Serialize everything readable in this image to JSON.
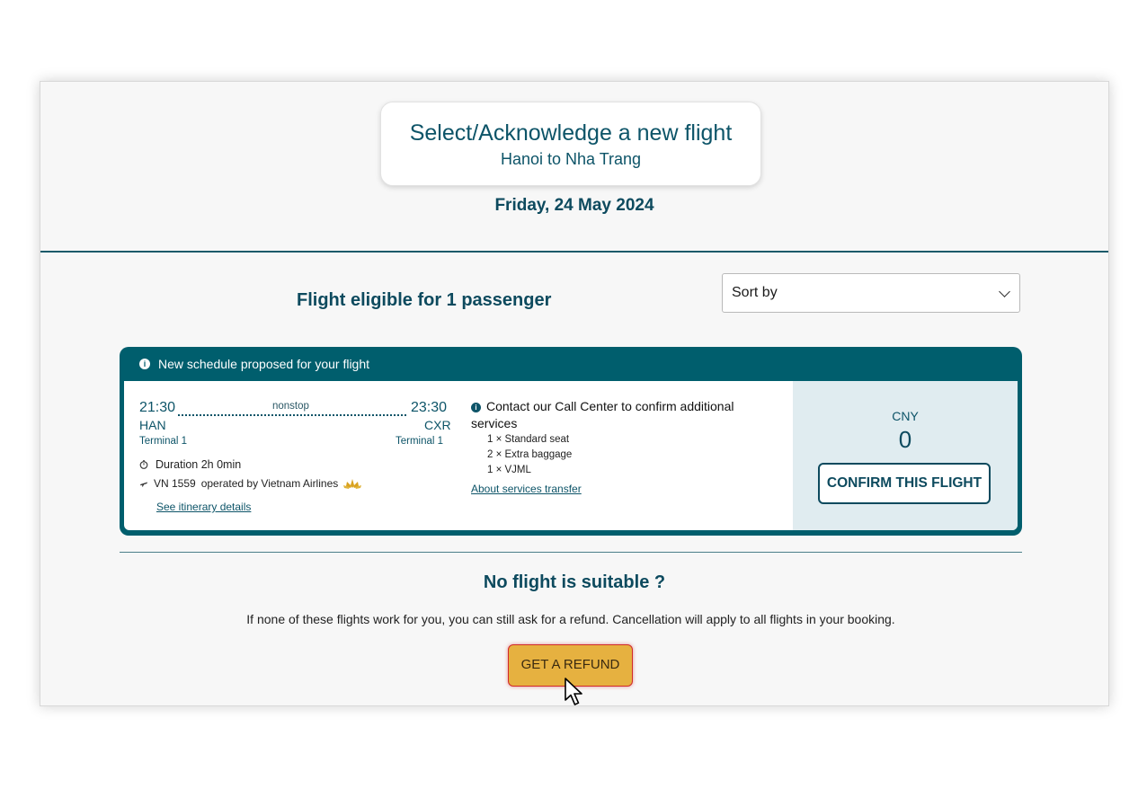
{
  "header": {
    "title": "Select/Acknowledge a new flight",
    "route": "Hanoi to Nha Trang",
    "date": "Friday, 24 May 2024"
  },
  "results": {
    "eligible_text": "Flight eligible for 1 passenger",
    "sort_label": "Sort by"
  },
  "flight_card": {
    "banner": "New schedule proposed for your flight",
    "departure_time": "21:30",
    "arrival_time": "23:30",
    "stops": "nonstop",
    "departure_code": "HAN",
    "arrival_code": "CXR",
    "departure_terminal": "Terminal 1",
    "arrival_terminal": "Terminal 1",
    "duration": "Duration 2h 0min",
    "flight_number": "VN 1559",
    "operator": "operated by Vietnam Airlines",
    "itinerary_link": "See itinerary details",
    "contact_text": "Contact our Call Center to confirm additional services",
    "services": [
      "1 × Standard seat",
      "2 × Extra baggage",
      "1 × VJML"
    ],
    "services_link": "About services transfer",
    "currency": "CNY",
    "amount": "0",
    "confirm_label": "CONFIRM THIS FLIGHT"
  },
  "refund": {
    "heading": "No flight is suitable ?",
    "text": "If none of these flights work for you, you can still ask for a refund. Cancellation will apply to all flights in your booking.",
    "button_label": "GET A REFUND"
  },
  "colors": {
    "brand_teal": "#005e6d",
    "refund_button": "#e6b140",
    "price_panel": "#e0ecf0"
  }
}
